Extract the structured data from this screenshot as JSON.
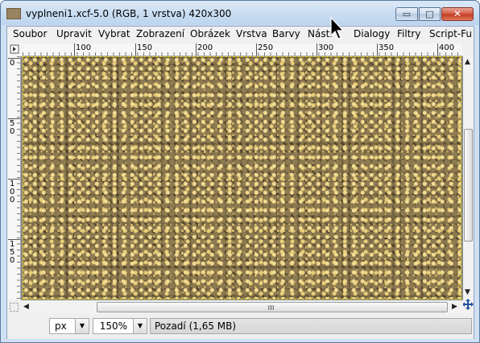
{
  "window": {
    "title": "vyplneni1.xcf-5.0 (RGB, 1 vrstva) 420x300",
    "controls": {
      "minimize": "▭",
      "maximize": "□",
      "close": "✕"
    }
  },
  "menubar": {
    "items": [
      "Soubor",
      "Upravit",
      "Vybrat",
      "Zobrazení",
      "Obrázek",
      "Vrstva",
      "Barvy",
      "Nástr",
      "Dialogy",
      "Filtry",
      "Script-Fu"
    ]
  },
  "rulers": {
    "horizontal": [
      "100",
      "150",
      "200",
      "250",
      "300",
      "350",
      "400"
    ],
    "vertical": [
      "0",
      "5\n0",
      "1\n0\n0",
      "1\n5\n0"
    ]
  },
  "statusbar": {
    "unit": "px",
    "zoom": "150%",
    "status": "Pozadí (1,65 MB)"
  },
  "icons": [
    "app-icon",
    "menu-nav-icon",
    "quick-mask-icon",
    "navigate-icon",
    "zoom-fit-icon",
    "mouse-cursor-icon"
  ]
}
